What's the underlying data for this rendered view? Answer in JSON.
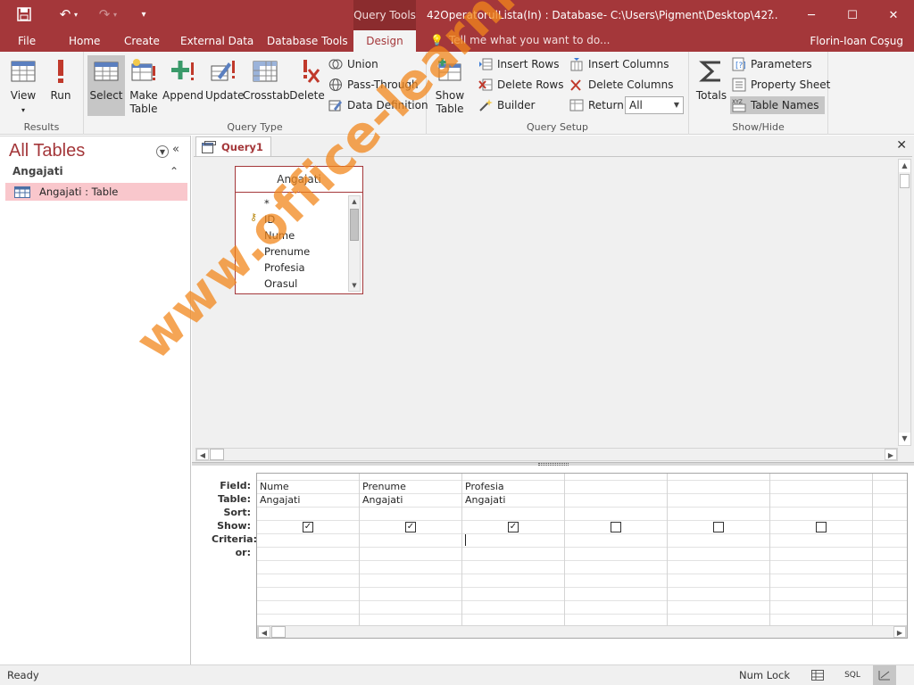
{
  "titlebar": {
    "contextual_tab": "Query Tools",
    "title": "42OperatorulLista(In) : Database- C:\\Users\\Pigment\\Desktop\\42...",
    "help": "?",
    "minimize": "─",
    "restore": "☐",
    "close": "✕"
  },
  "tabs": [
    {
      "label": "File"
    },
    {
      "label": "Home"
    },
    {
      "label": "Create"
    },
    {
      "label": "External Data"
    },
    {
      "label": "Database Tools"
    },
    {
      "label": "Design"
    }
  ],
  "tell_me": "Tell me what you want to do...",
  "user_name": "Florin-Ioan Coşug",
  "ribbon": {
    "results": {
      "label": "Results",
      "view": "View",
      "run": "Run"
    },
    "query_type": {
      "label": "Query Type",
      "select": "Select",
      "make_table_1": "Make",
      "make_table_2": "Table",
      "append": "Append",
      "update": "Update",
      "crosstab": "Crosstab",
      "delete": "Delete",
      "union": "Union",
      "pass_through": "Pass-Through",
      "data_definition": "Data Definition"
    },
    "query_setup": {
      "label": "Query Setup",
      "show_table_1": "Show",
      "show_table_2": "Table",
      "insert_rows": "Insert Rows",
      "delete_rows": "Delete Rows",
      "builder": "Builder",
      "insert_columns": "Insert Columns",
      "delete_columns": "Delete Columns",
      "return_label": "Return:",
      "return_value": "All"
    },
    "show_hide": {
      "label": "Show/Hide",
      "totals": "Totals",
      "parameters": "Parameters",
      "property_sheet": "Property Sheet",
      "table_names": "Table Names"
    }
  },
  "nav": {
    "title": "All Tables",
    "group": "Angajati",
    "item": "Angajati : Table"
  },
  "document": {
    "tab": "Query1",
    "close": "✕",
    "table_box": {
      "title": "Angajati",
      "fields": [
        "*",
        "ID",
        "Nume",
        "Prenume",
        "Profesia",
        "Orasul"
      ]
    }
  },
  "grid": {
    "row_labels": [
      "Field:",
      "Table:",
      "Sort:",
      "Show:",
      "Criteria:",
      "or:"
    ],
    "columns": [
      {
        "field": "Nume",
        "table": "Angajati",
        "show": true
      },
      {
        "field": "Prenume",
        "table": "Angajati",
        "show": true
      },
      {
        "field": "Profesia",
        "table": "Angajati",
        "show": true
      },
      {
        "field": "",
        "table": "",
        "show": false
      },
      {
        "field": "",
        "table": "",
        "show": false
      },
      {
        "field": "",
        "table": "",
        "show": false
      },
      {
        "field": "",
        "table": "",
        "show": false
      }
    ]
  },
  "status": {
    "text": "Ready",
    "numlock": "Num Lock",
    "sql_view": "SQL"
  },
  "watermark": "www.office-learning.ro",
  "colors": {
    "accent": "#a4373a",
    "nav_selected": "#f9c7cc",
    "watermark": "#f2871c"
  }
}
